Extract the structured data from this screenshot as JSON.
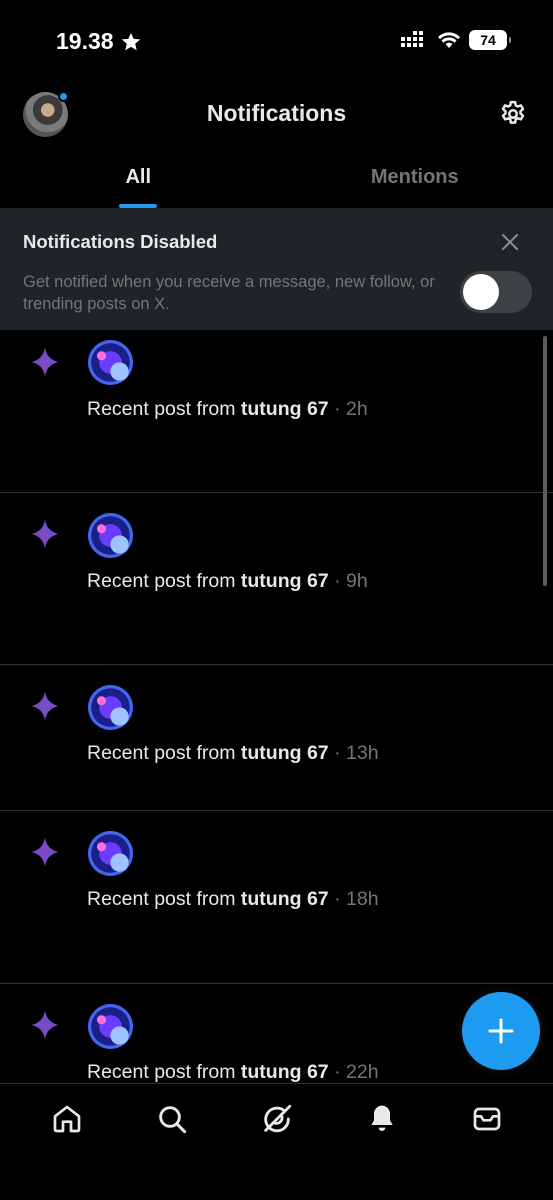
{
  "status_bar": {
    "time": "19.38",
    "battery": "74"
  },
  "header": {
    "title": "Notifications"
  },
  "tabs": [
    {
      "label": "All",
      "active": true
    },
    {
      "label": "Mentions",
      "active": false
    }
  ],
  "banner": {
    "title": "Notifications Disabled",
    "body": "Get notified when you receive a message, new follow, or trending posts on X.",
    "toggle_on": false
  },
  "notifications": [
    {
      "prefix": "Recent post from ",
      "author": "tutung 67",
      "sep": " · ",
      "time": "2h"
    },
    {
      "prefix": "Recent post from ",
      "author": "tutung 67",
      "sep": " · ",
      "time": "9h"
    },
    {
      "prefix": "Recent post from ",
      "author": "tutung 67",
      "sep": " · ",
      "time": "13h"
    },
    {
      "prefix": "Recent post from ",
      "author": "tutung 67",
      "sep": " · ",
      "time": "18h"
    },
    {
      "prefix": "Recent post from ",
      "author": "tutung 67",
      "sep": " · ",
      "time": "22h"
    }
  ],
  "icons": {
    "star": "star-icon",
    "signal": "signal-icon",
    "wifi": "wifi-icon",
    "settings": "gear-icon",
    "close": "close-icon",
    "sparkle": "sparkle-icon",
    "compose": "plus-icon",
    "home": "home-icon",
    "search": "search-icon",
    "grok": "grok-icon",
    "bell": "bell-icon",
    "mail": "mail-icon"
  },
  "colors": {
    "accent": "#1d9bf0",
    "sparkle": "#794bc4",
    "muted": "#71767b",
    "banner_bg": "#202327"
  }
}
